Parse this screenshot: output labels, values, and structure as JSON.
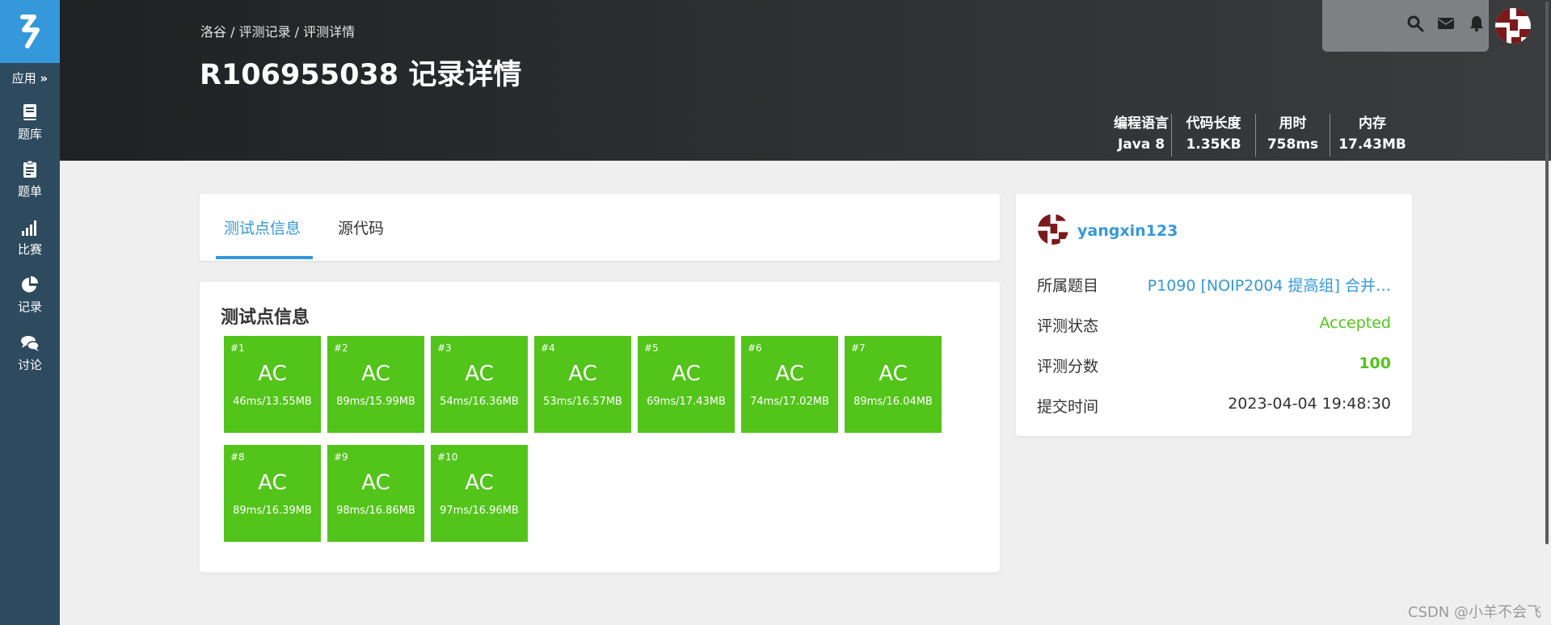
{
  "sidebar": {
    "apps_label": "应用",
    "items": [
      {
        "label": "题库",
        "icon": "book-icon"
      },
      {
        "label": "题单",
        "icon": "clipboard-icon"
      },
      {
        "label": "比赛",
        "icon": "bar-chart-icon"
      },
      {
        "label": "记录",
        "icon": "pie-chart-icon"
      },
      {
        "label": "讨论",
        "icon": "comments-icon"
      }
    ]
  },
  "header": {
    "breadcrumb": "洛谷 / 评测记录 / 评测详情",
    "title": "R106955038 记录详情",
    "stats": [
      {
        "key": "编程语言",
        "value": "Java 8"
      },
      {
        "key": "代码长度",
        "value": "1.35KB"
      },
      {
        "key": "用时",
        "value": "758ms"
      },
      {
        "key": "内存",
        "value": "17.43MB"
      }
    ]
  },
  "tabs": [
    "测试点信息",
    "源代码"
  ],
  "testcases": {
    "title": "测试点信息",
    "items": [
      {
        "num": "#1",
        "status": "AC",
        "detail": "46ms/13.55MB"
      },
      {
        "num": "#2",
        "status": "AC",
        "detail": "89ms/15.99MB"
      },
      {
        "num": "#3",
        "status": "AC",
        "detail": "54ms/16.36MB"
      },
      {
        "num": "#4",
        "status": "AC",
        "detail": "53ms/16.57MB"
      },
      {
        "num": "#5",
        "status": "AC",
        "detail": "69ms/17.43MB"
      },
      {
        "num": "#6",
        "status": "AC",
        "detail": "74ms/17.02MB"
      },
      {
        "num": "#7",
        "status": "AC",
        "detail": "89ms/16.04MB"
      },
      {
        "num": "#8",
        "status": "AC",
        "detail": "89ms/16.39MB"
      },
      {
        "num": "#9",
        "status": "AC",
        "detail": "98ms/16.86MB"
      },
      {
        "num": "#10",
        "status": "AC",
        "detail": "97ms/16.96MB"
      }
    ]
  },
  "info": {
    "username": "yangxin123",
    "rows": [
      {
        "key": "所属题目",
        "value": "P1090 [NOIP2004 提高组] 合并…"
      },
      {
        "key": "评测状态",
        "value": "Accepted"
      },
      {
        "key": "评测分数",
        "value": "100"
      },
      {
        "key": "提交时间",
        "value": "2023-04-04 19:48:30"
      }
    ]
  },
  "watermark": "CSDN @小羊不会飞",
  "colors": {
    "accent": "#3498db",
    "ac_green": "#52c41a",
    "sidebar": "#2e4a5f",
    "avatar_red": "#7a1a1a"
  }
}
